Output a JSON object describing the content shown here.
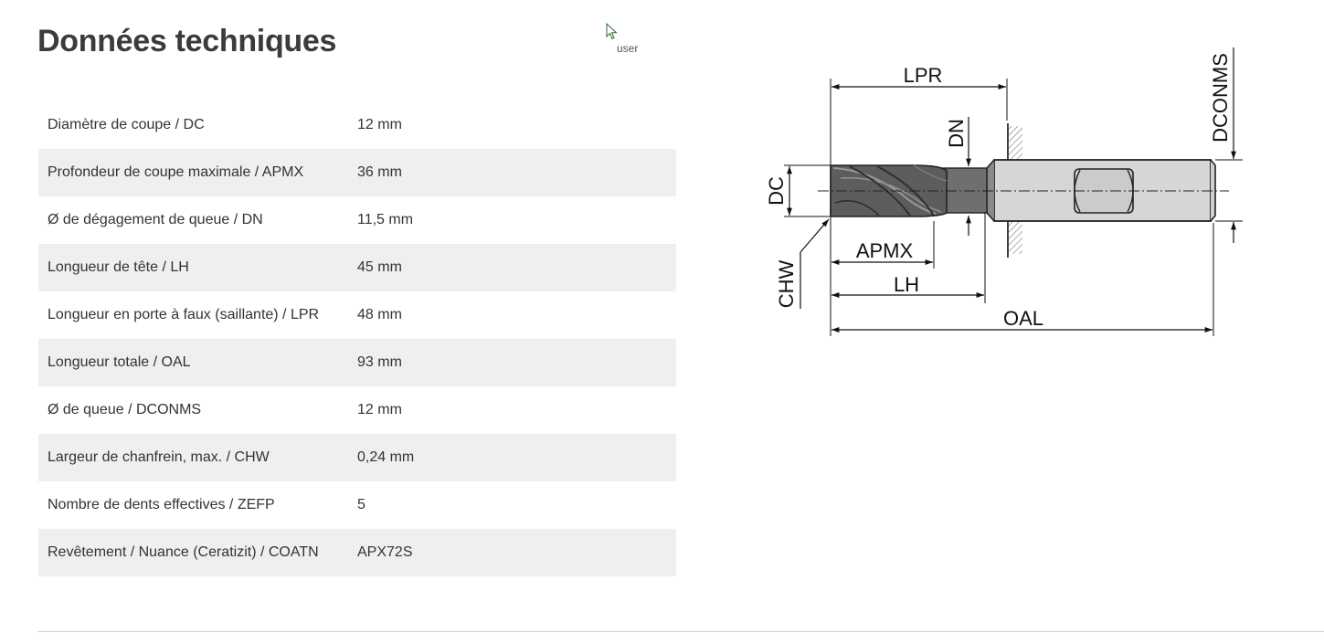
{
  "page": {
    "title": "Données techniques"
  },
  "cursor": {
    "label": "user"
  },
  "specs": [
    {
      "label": "Diamètre de coupe / DC",
      "value": "12 mm"
    },
    {
      "label": "Profondeur de coupe maximale / APMX",
      "value": "36 mm"
    },
    {
      "label": "Ø de dégagement de queue / DN",
      "value": "11,5 mm"
    },
    {
      "label": "Longueur de tête / LH",
      "value": "45 mm"
    },
    {
      "label": "Longueur en porte à faux (saillante) / LPR",
      "value": "48 mm"
    },
    {
      "label": "Longueur totale / OAL",
      "value": "93 mm"
    },
    {
      "label": "Ø de queue / DCONMS",
      "value": "12 mm"
    },
    {
      "label": "Largeur de chanfrein, max. / CHW",
      "value": "0,24 mm"
    },
    {
      "label": "Nombre de dents effectives / ZEFP",
      "value": "5"
    },
    {
      "label": "Revêtement / Nuance (Ceratizit) / COATN",
      "value": "APX72S"
    }
  ],
  "diagram": {
    "labels": {
      "lpr": "LPR",
      "dconms": "DCONMS",
      "dn": "DN",
      "dc": "DC",
      "apmx": "APMX",
      "chw": "CHW",
      "lh": "LH",
      "oal": "OAL"
    }
  }
}
